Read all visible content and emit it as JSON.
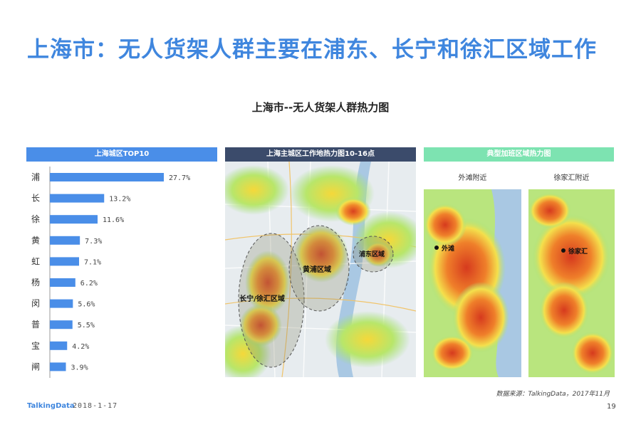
{
  "page": {
    "title": "上海市：无人货架人群主要在浦东、长宁和徐汇区域工作",
    "subtitle": "上海市--无人货架人群热力图",
    "source": "数据来源：TalkingData，2017年11月",
    "logo": "TalkingData",
    "date": "2018-1-17",
    "page_number": "19"
  },
  "panels": {
    "bar_header": "上海城区TOP10",
    "map_header": "上海主城区工作地热力图10-16点",
    "zone_header": "典型加班区域热力图",
    "zone_label_1": "外滩附近",
    "zone_label_2": "徐家汇附近"
  },
  "map_labels": {
    "changning": "长宁/徐汇区域",
    "huangpu": "黄浦区域",
    "pudong": "浦东区域",
    "bund": "外滩",
    "xujiahui": "徐家汇"
  },
  "colors": {
    "title": "#3f86de",
    "bar": "#4a8ee8",
    "bar_header": "#4a8ee8",
    "map_header": "#3b4b6b",
    "zone_header": "#7de3b1"
  },
  "chart_data": {
    "type": "bar",
    "orientation": "horizontal",
    "title": "上海城区TOP10",
    "categories": [
      "浦",
      "长",
      "徐",
      "黄",
      "虹",
      "杨",
      "闵",
      "普",
      "宝",
      "闸"
    ],
    "values": [
      27.7,
      13.2,
      11.6,
      7.3,
      7.1,
      6.2,
      5.6,
      5.5,
      4.2,
      3.9
    ],
    "value_labels": [
      "27.7%",
      "13.2%",
      "11.6%",
      "7.3%",
      "7.1%",
      "6.2%",
      "5.6%",
      "5.5%",
      "4.2%",
      "3.9%"
    ],
    "unit": "%",
    "grid": false,
    "legend": "none"
  }
}
